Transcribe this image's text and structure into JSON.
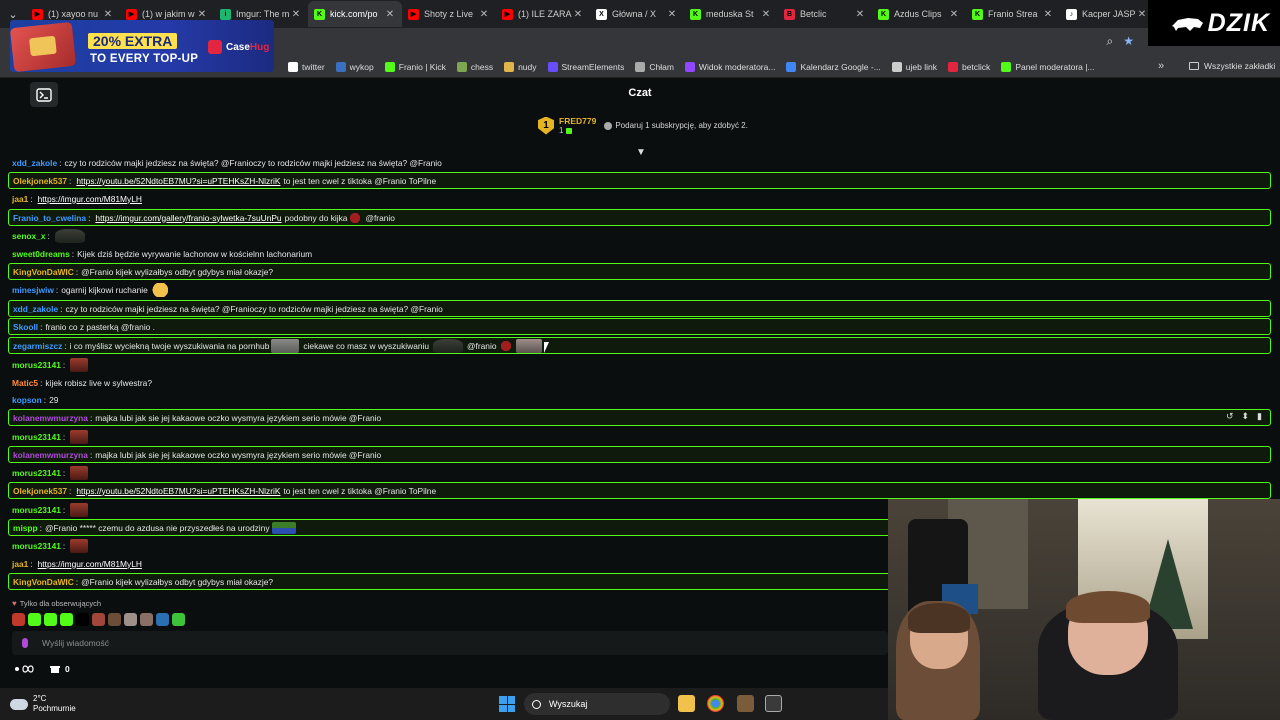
{
  "browser": {
    "tabs": [
      {
        "label": "(1) xayoo nu",
        "color": "#ff0000",
        "glyph": "▶",
        "active": false
      },
      {
        "label": "(1) w jakim w",
        "color": "#ff0000",
        "glyph": "▶",
        "active": false
      },
      {
        "label": "Imgur: The m",
        "color": "#1bb76e",
        "glyph": "i",
        "active": false
      },
      {
        "label": "kick.com/po",
        "color": "#53fc18",
        "glyph": "K",
        "active": true
      },
      {
        "label": "Shoty z Live",
        "color": "#ff0000",
        "glyph": "▶",
        "active": false
      },
      {
        "label": "(1) ILE ZARA",
        "color": "#ff0000",
        "glyph": "▶",
        "active": false
      },
      {
        "label": "Główna / X",
        "color": "#ffffff",
        "glyph": "X",
        "active": false
      },
      {
        "label": "meduska St",
        "color": "#53fc18",
        "glyph": "K",
        "active": false
      },
      {
        "label": "Betclic",
        "color": "#e3263f",
        "glyph": "B",
        "active": false
      },
      {
        "label": "Azdus Clips",
        "color": "#53fc18",
        "glyph": "K",
        "active": false
      },
      {
        "label": "Franio Strea",
        "color": "#53fc18",
        "glyph": "K",
        "active": false
      },
      {
        "label": "Kacper JASP",
        "color": "#ffffff",
        "glyph": "♪",
        "active": false
      }
    ],
    "new_tab": "+",
    "bookmarks": [
      {
        "label": "twitter",
        "color": "#ffffff"
      },
      {
        "label": "wykop",
        "color": "#3b6fbf"
      },
      {
        "label": "Franio | Kick",
        "color": "#53fc18"
      },
      {
        "label": "chess",
        "color": "#7fa650"
      },
      {
        "label": "nudy",
        "color": "#e0b64a"
      },
      {
        "label": "StreamElements",
        "color": "#6a4cff"
      },
      {
        "label": "Chłam",
        "color": "#aaaaaa"
      },
      {
        "label": "Widok moderatora...",
        "color": "#9146ff"
      },
      {
        "label": "Kalendarz Google -...",
        "color": "#4285f4"
      },
      {
        "label": "ujeb link",
        "color": "#cccccc"
      },
      {
        "label": "betclick",
        "color": "#e3263f"
      },
      {
        "label": "Panel moderatora |...",
        "color": "#53fc18"
      }
    ],
    "bookmarks_more": "»",
    "all_bookmarks": "Wszystkie zakładki"
  },
  "overlay": {
    "brand": "DZIK",
    "ad_line1": "20% EXTRA",
    "ad_line2": "TO EVERY TOP-UP",
    "ad_brand_a": "Case",
    "ad_brand_b": "Hug"
  },
  "chat": {
    "title": "Czat",
    "top_gifter": {
      "rank": "1",
      "name": "FRED779",
      "count": "1"
    },
    "sub_prompt": "Podaruj 1 subskrypcję, aby zdobyć 2.",
    "messages": [
      {
        "user": "xdd_zakole",
        "color": "#3d9bff",
        "text": "czy to rodziców majki jedziesz na święta? @Franioczy to rodziców majki jedziesz na święta? @Franio",
        "hl": false
      },
      {
        "user": "Olekjonek537",
        "color": "#e6b422",
        "link": "https://youtu.be/52NdtoEB7MU?si=uPTEHKsZH-NlzriK",
        "text": "to jest ten cwel z tiktoka @Franio ToPilne",
        "hl": true
      },
      {
        "user": "jaa1",
        "color": "#e6b422",
        "link": "https://imgur.com/M81MyLH",
        "text": "",
        "hl": false
      },
      {
        "user": "Franio_to_cwelina",
        "color": "#3d9bff",
        "link": "https://imgur.com/gallery/franio-sylwetka-7suUnPu",
        "text": "podobny do kijka",
        "emote": "e-red",
        "text2": "@franio",
        "hl": true
      },
      {
        "user": "senox_x",
        "color": "#53fc18",
        "emote": "e-tank",
        "text": "",
        "hl": false
      },
      {
        "user": "sweet0dreams",
        "color": "#53fc18",
        "text": "Kijek dziś będzie wyrywanie lachonow w kościelnn lachonarium",
        "hl": false
      },
      {
        "user": "KingVonDaWIC",
        "color": "#e6b422",
        "text": "@Franio kijek wylizałbys odbyt gdybys miał okazje?",
        "hl": true
      },
      {
        "user": "minesjwiw",
        "color": "#3d9bff",
        "text": "ogarnij kijkowi ruchanie",
        "emote": "e-sweat",
        "hl": false
      },
      {
        "user": "xdd_zakole",
        "color": "#3d9bff",
        "text": "czy to rodziców majki jedziesz na święta? @Franioczy to rodziców majki jedziesz na święta? @Franio",
        "hl": true
      },
      {
        "user": "Skooll",
        "color": "#3d9bff",
        "text": "franio co z pasterką @franio .",
        "hl": true
      },
      {
        "user": "zegarmiszcz",
        "color": "#3d9bff",
        "text": "i co myślisz wyciekną twoje wyszukiwania na pornhub",
        "emote": "e-face",
        "text2": "ciekawe co masz w wyszukiwaniu",
        "emote2": "e-tank",
        "text3": "@franio",
        "hl": true
      },
      {
        "user": "morus23141",
        "color": "#53fc18",
        "emote": "e-rage",
        "text": "",
        "hl": false
      },
      {
        "user": "Matic5",
        "color": "#ff8c3a",
        "text": "kijek robisz live w sylwestra?",
        "hl": false
      },
      {
        "user": "kopson",
        "color": "#3d9bff",
        "text": "29",
        "hl": false
      },
      {
        "user": "kolanemwmurzyna",
        "color": "#b04ad9",
        "text": "majka lubi jak sie jej kakaowe oczko wysmyra językiem serio mówie @Franio",
        "hl": true
      },
      {
        "user": "morus23141",
        "color": "#53fc18",
        "emote": "e-rage",
        "text": "",
        "hl": false
      },
      {
        "user": "kolanemwmurzyna",
        "color": "#b04ad9",
        "text": "majka lubi jak sie jej kakaowe oczko wysmyra językiem serio mówie @Franio",
        "hl": true
      },
      {
        "user": "morus23141",
        "color": "#53fc18",
        "emote": "e-rage",
        "text": "",
        "hl": false
      },
      {
        "user": "Olekjonek537",
        "color": "#e6b422",
        "link": "https://youtu.be/52NdtoEB7MU?si=uPTEHKsZH-NlzriK",
        "text": "to jest ten cwel z tiktoka @Franio ToPilne",
        "hl": true
      },
      {
        "user": "morus23141",
        "color": "#53fc18",
        "emote": "e-rage",
        "text": "",
        "hl": false
      },
      {
        "user": "mispp",
        "color": "#53fc18",
        "text": "@Franio ***** czemu do azdusa nie przyszedłeś na urodziny",
        "emote": "e-pepe",
        "hl": true
      },
      {
        "user": "morus23141",
        "color": "#53fc18",
        "emote": "e-rage",
        "text": "",
        "hl": false
      },
      {
        "user": "jaa1",
        "color": "#e6b422",
        "link": "https://imgur.com/M81MyLH",
        "text": "",
        "hl": false
      },
      {
        "user": "KingVonDaWIC",
        "color": "#e6b422",
        "text": "@Franio kijek wylizałbys odbyt gdybys miał okazje?",
        "hl": true
      }
    ],
    "followers_only": "Tylko dla obserwujących",
    "input_placeholder": "Wyślij wiadomość",
    "bottom_count": "0"
  },
  "taskbar": {
    "temp": "2°C",
    "weather": "Pochmurnie",
    "search": "Wyszukaj"
  }
}
